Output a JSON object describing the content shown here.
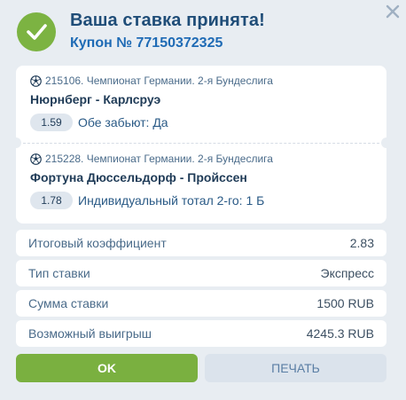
{
  "header": {
    "title": "Ваша ставка принята!",
    "coupon": "Купон № 77150372325"
  },
  "bets": [
    {
      "league": "215106. Чемпионат Германии. 2-я Бундеслига",
      "match": "Нюрнберг - Карлсруэ",
      "odd": "1.59",
      "description": "Обе забьют: Да"
    },
    {
      "league": "215228. Чемпионат Германии. 2-я Бундеслига",
      "match": "Фортуна Дюссельдорф - Пройссен",
      "odd": "1.78",
      "description": "Индивидуальный тотал 2-го: 1 Б"
    }
  ],
  "summary": [
    {
      "label": "Итоговый коэффициент",
      "value": "2.83"
    },
    {
      "label": "Тип ставки",
      "value": "Экспресс"
    },
    {
      "label": "Сумма ставки",
      "value": "1500 RUB"
    },
    {
      "label": "Возможный выигрыш",
      "value": "4245.3 RUB"
    }
  ],
  "buttons": {
    "ok": "OK",
    "print": "ПЕЧАТЬ"
  },
  "icons": {
    "success": "check-circle-icon",
    "close": "close-icon",
    "sport": "soccer-ball-icon"
  },
  "colors": {
    "accent_green": "#7cb342",
    "title_blue": "#1f4d78",
    "coupon_blue": "#1f6bb5"
  }
}
